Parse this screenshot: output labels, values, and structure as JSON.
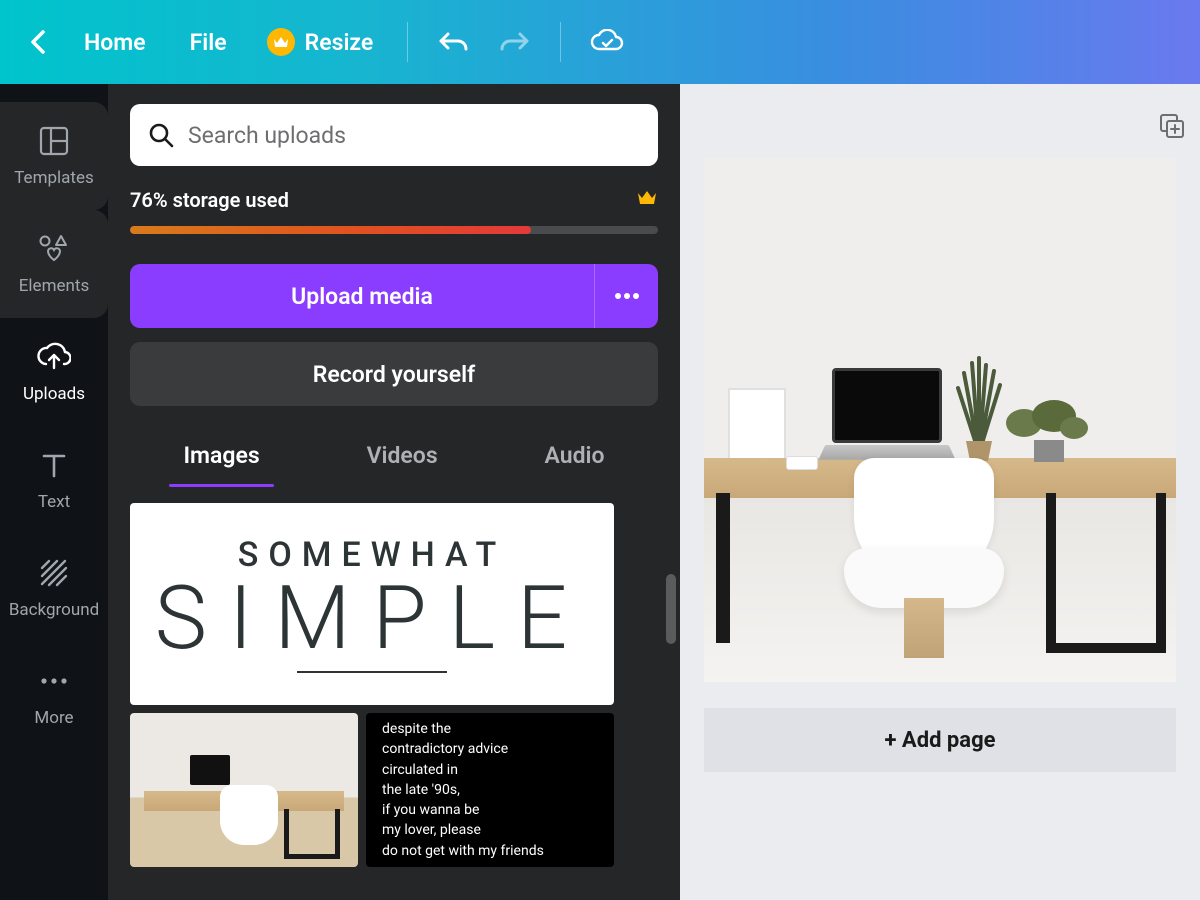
{
  "topbar": {
    "home": "Home",
    "file": "File",
    "resize": "Resize"
  },
  "rail": {
    "templates": "Templates",
    "elements": "Elements",
    "uploads": "Uploads",
    "text": "Text",
    "background": "Background",
    "more": "More"
  },
  "panel": {
    "search_placeholder": "Search uploads",
    "storage_text": "76% storage used",
    "storage_percent": 76,
    "upload_label": "Upload media",
    "record_label": "Record yourself",
    "tabs": {
      "images": "Images",
      "videos": "Videos",
      "audio": "Audio"
    },
    "thumb1": {
      "line1": "SOMEWHAT",
      "line2": "SIMPLE"
    },
    "thumb3_lines": {
      "l1": "despite the",
      "l2": "contradictory advice",
      "l3": "circulated in",
      "l4": "the late '90s,",
      "l5": "if you wanna be",
      "l6": "my lover, please",
      "l7": "do not get with my friends"
    }
  },
  "canvas": {
    "add_page": "+ Add page"
  }
}
